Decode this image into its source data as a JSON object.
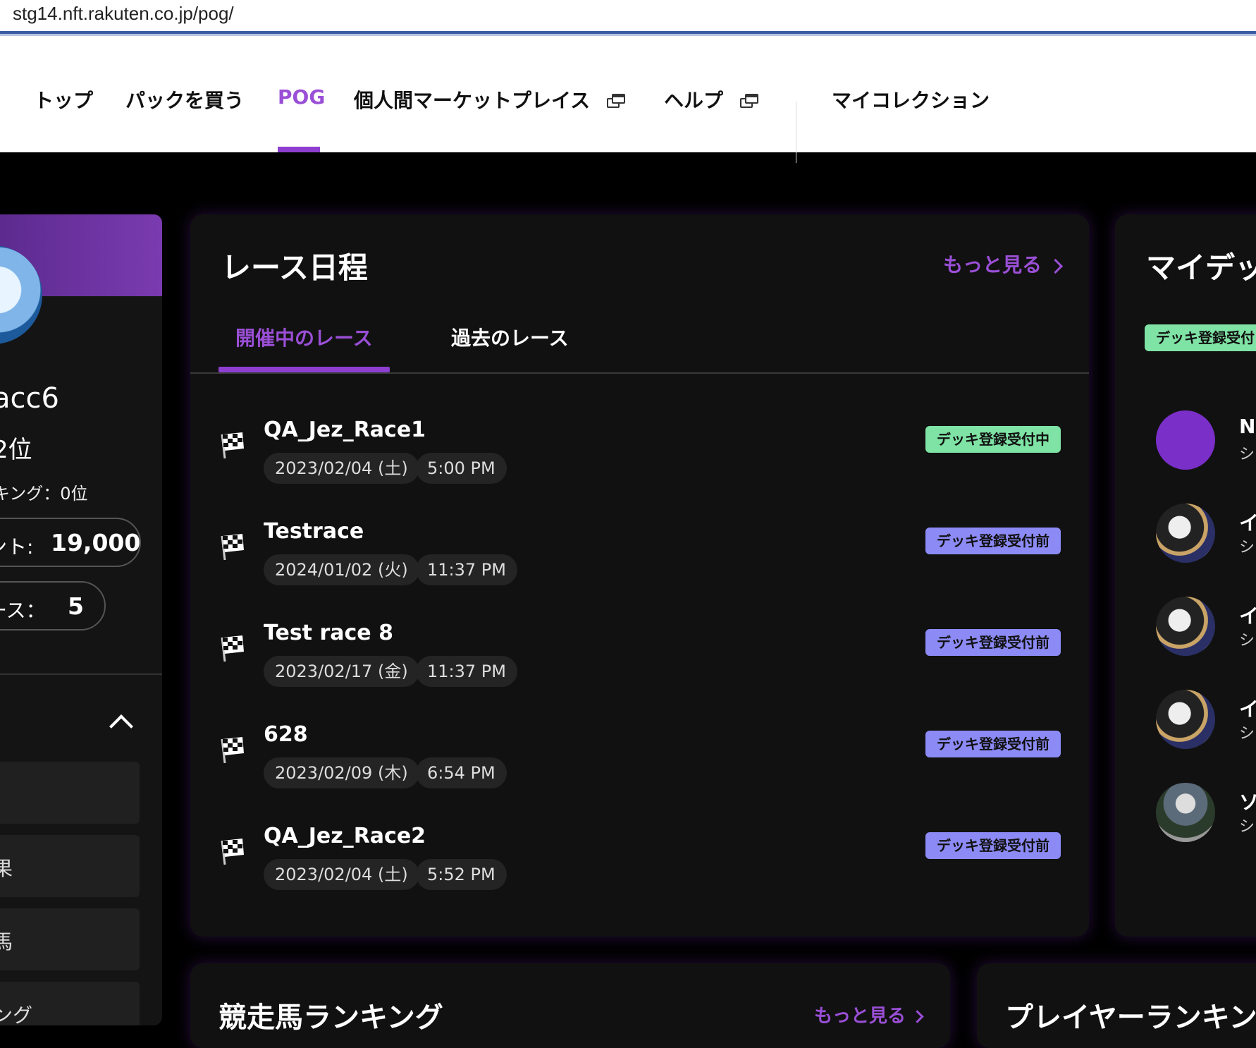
{
  "browser": {
    "url": "stg14.nft.rakuten.co.jp/pog/"
  },
  "nav": {
    "items": [
      {
        "label": "トップ"
      },
      {
        "label": "パックを買う"
      },
      {
        "label": "POG"
      },
      {
        "label": "個人間マーケットプレイス"
      },
      {
        "label": "ヘルプ"
      },
      {
        "label": "マイコレクション"
      }
    ],
    "active": "POG"
  },
  "profile": {
    "name": "acc6",
    "rank": "2位",
    "ranking_line": "キング：0位",
    "points_label": "ント:",
    "points_value": "19,000",
    "races_label": "ース：",
    "races_value": "5",
    "menu": [
      {
        "label": ""
      },
      {
        "label": "果"
      },
      {
        "label": "馬"
      },
      {
        "label": "ング"
      }
    ]
  },
  "race_schedule": {
    "title": "レース日程",
    "more": "もっと見る",
    "tabs": [
      {
        "label": "開催中のレース"
      },
      {
        "label": "過去のレース"
      }
    ],
    "races": [
      {
        "name": "QA_Jez_Race1",
        "date": "2023/02/04 (土)",
        "time": "5:00 PM",
        "status": "デッキ登録受付中",
        "status_type": "open"
      },
      {
        "name": "Testrace",
        "date": "2024/01/02 (火)",
        "time": "11:37 PM",
        "status": "デッキ登録受付前",
        "status_type": "pre"
      },
      {
        "name": "Test race 8",
        "date": "2023/02/17 (金)",
        "time": "11:37 PM",
        "status": "デッキ登録受付前",
        "status_type": "pre"
      },
      {
        "name": "628",
        "date": "2023/02/09 (木)",
        "time": "6:54 PM",
        "status": "デッキ登録受付前",
        "status_type": "pre"
      },
      {
        "name": "QA_Jez_Race2",
        "date": "2023/02/04 (土)",
        "time": "5:52 PM",
        "status": "デッキ登録受付前",
        "status_type": "pre"
      }
    ]
  },
  "my_deck": {
    "title": "マイデッ",
    "badge": "デッキ登録受付",
    "items": [
      {
        "name": "NI",
        "sub": "シ"
      },
      {
        "name": "イ",
        "sub": "シ"
      },
      {
        "name": "イ",
        "sub": "シ"
      },
      {
        "name": "イ",
        "sub": "シ"
      },
      {
        "name": "ソ",
        "sub": "シ"
      }
    ]
  },
  "bottom": {
    "horse_ranking_title": "競走馬ランキング",
    "horse_ranking_more": "もっと見る",
    "player_ranking_title": "プレイヤーランキン"
  },
  "colors": {
    "accent": "#9a4fd6",
    "status_open": "#7ee3a4",
    "status_pre": "#8c8af5",
    "card_bg": "#111111"
  }
}
